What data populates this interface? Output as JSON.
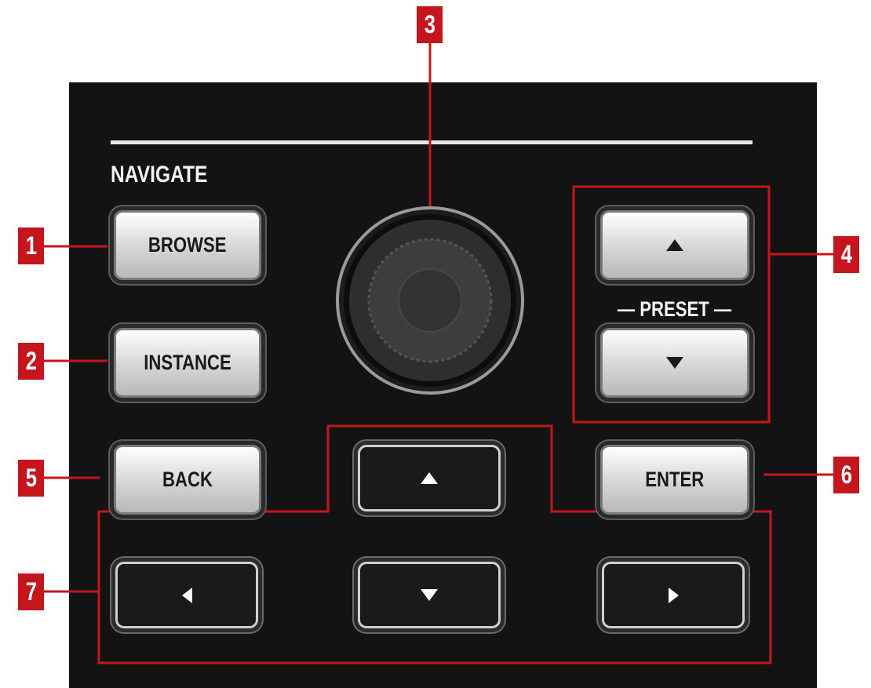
{
  "section_title": "NAVIGATE",
  "buttons": {
    "browse": "BROWSE",
    "instance": "INSTANCE",
    "back": "BACK",
    "enter": "ENTER",
    "preset_label": "— PRESET —"
  },
  "callouts": [
    "1",
    "2",
    "3",
    "4",
    "5",
    "6",
    "7"
  ],
  "colors": {
    "panel": "#131313",
    "callout_red": "#c5161d",
    "highlight_box": "#c5161d"
  }
}
